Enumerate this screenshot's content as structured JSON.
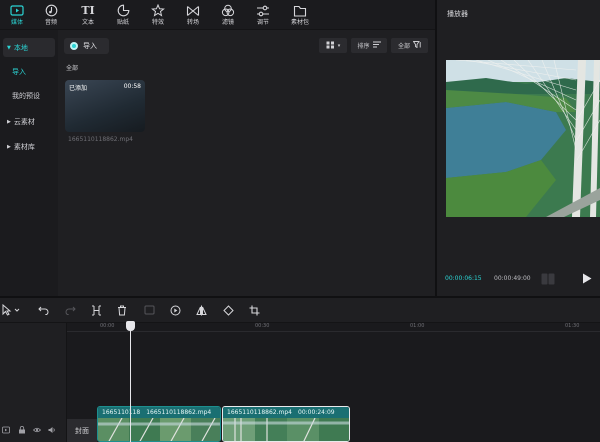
{
  "toolbar": {
    "tools": [
      {
        "label": "媒体",
        "icon": "media-icon"
      },
      {
        "label": "音频",
        "icon": "audio-icon"
      },
      {
        "label": "文本",
        "icon": "text-icon"
      },
      {
        "label": "贴纸",
        "icon": "sticker-icon"
      },
      {
        "label": "特效",
        "icon": "effects-icon"
      },
      {
        "label": "转场",
        "icon": "transition-icon"
      },
      {
        "label": "滤镜",
        "icon": "filter-icon"
      },
      {
        "label": "调节",
        "icon": "adjust-icon"
      },
      {
        "label": "素材包",
        "icon": "asset-pack-icon"
      }
    ],
    "active_tool": "媒体",
    "ti_glyph": "TI"
  },
  "nav": {
    "local": "本地",
    "import": "导入",
    "presets": "我的预设",
    "cloud": "云素材",
    "library": "素材库"
  },
  "content": {
    "import_button": "导入",
    "sort_label": "排序",
    "filter_label": "全部",
    "section_label": "全部",
    "media": {
      "badge": "已添加",
      "duration": "00:58",
      "filename": "1665110118862.mp4"
    }
  },
  "player": {
    "title": "播放器",
    "time_current": "00:00:06:15",
    "time_total": "00:00:49:00"
  },
  "timeline": {
    "ruler_labels": [
      "00:00",
      "00:30",
      "01:00",
      "01:30"
    ],
    "cover_label": "封面",
    "clips": [
      {
        "name": "1665110118",
        "extra": "1665110118862.mp4"
      },
      {
        "name": "1665110118862.mp4",
        "extra": "00:00:24:09"
      }
    ]
  },
  "colors": {
    "accent": "#2bd4d4",
    "panel": "#1f1f22",
    "clip_border": "#1d8f8f"
  }
}
